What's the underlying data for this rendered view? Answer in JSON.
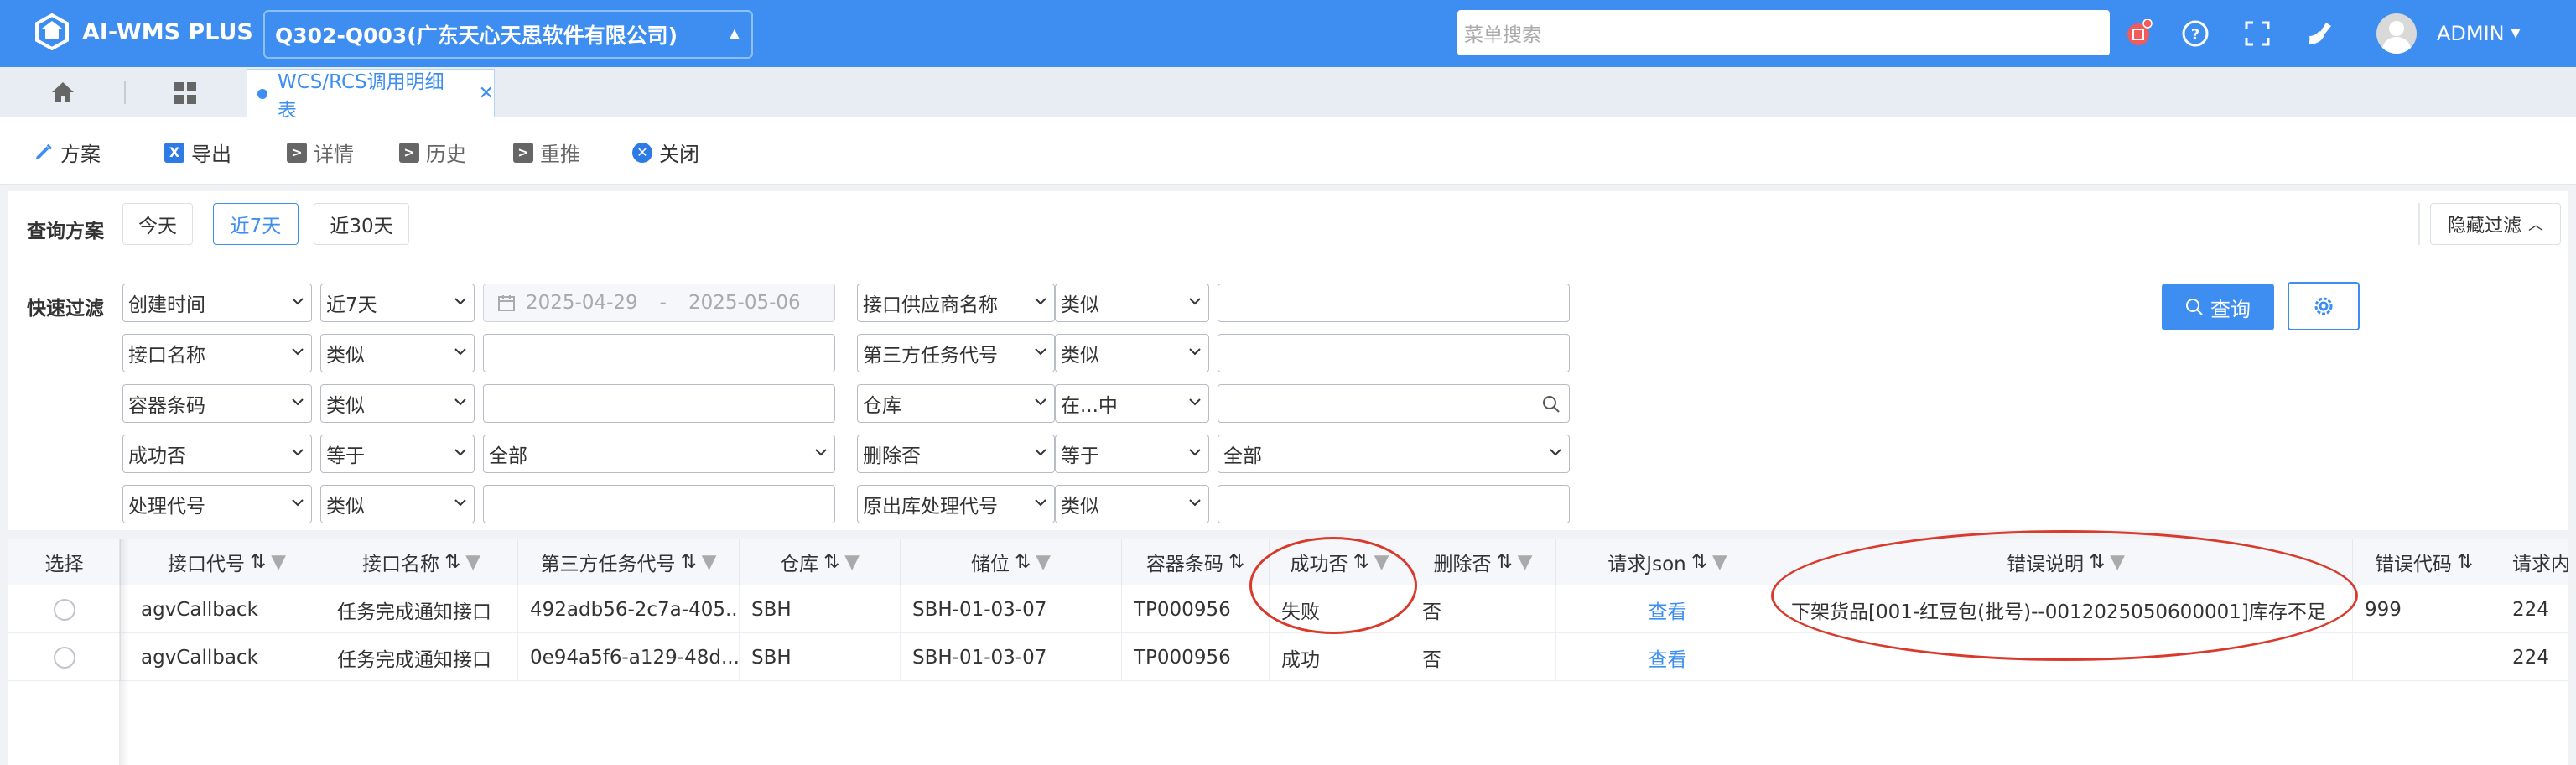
{
  "app": {
    "title": "AI-WMS PLUS",
    "company": "Q302-Q003(广东天心天思软件有限公司)",
    "search_placeholder": "菜单搜索",
    "user": "ADMIN",
    "brand_color": "#3d8ef0"
  },
  "tabs": [
    {
      "label": "WCS/RCS调用明细表",
      "active": true
    }
  ],
  "toolbar": {
    "items": [
      {
        "label": "方案",
        "icon": "plan-icon"
      },
      {
        "label": "导出",
        "icon": "excel-icon"
      },
      {
        "label": "详情",
        "icon": "detail-icon"
      },
      {
        "label": "历史",
        "icon": "history-icon"
      },
      {
        "label": "重推",
        "icon": "repush-icon"
      },
      {
        "label": "关闭",
        "icon": "close-circle-icon"
      }
    ]
  },
  "query": {
    "label": "查询方案",
    "options": [
      "今天",
      "近7天",
      "近30天"
    ],
    "active": "近7天",
    "hide_filter": "隐藏过滤"
  },
  "quick_filter": {
    "label": "快速过滤",
    "left": [
      {
        "field": "创建时间",
        "op": "近7天",
        "date_from": "2025-04-29",
        "date_to": "2025-05-06",
        "date_sep": "-"
      },
      {
        "field": "接口名称",
        "op": "类似",
        "value": ""
      },
      {
        "field": "容器条码",
        "op": "类似",
        "value": ""
      },
      {
        "field": "成功否",
        "op": "等于",
        "value": "全部"
      },
      {
        "field": "处理代号",
        "op": "类似",
        "value": ""
      }
    ],
    "right": [
      {
        "field": "接口供应商名称",
        "op": "类似",
        "value": ""
      },
      {
        "field": "第三方任务代号",
        "op": "类似",
        "value": ""
      },
      {
        "field": "仓库",
        "op": "在...中",
        "value": ""
      },
      {
        "field": "删除否",
        "op": "等于",
        "value": "全部"
      },
      {
        "field": "原出库处理代号",
        "op": "类似",
        "value": ""
      }
    ],
    "search_label": "查询"
  },
  "table": {
    "columns": [
      "选择",
      "接口代号",
      "接口名称",
      "第三方任务代号",
      "仓库",
      "储位",
      "容器条码",
      "成功否",
      "删除否",
      "请求Json",
      "错误说明",
      "错误代码",
      "请求内"
    ],
    "rows": [
      [
        "",
        "agvCallback",
        "任务完成通知接口",
        "492adb56-2c7a-405...",
        "SBH",
        "SBH-01-03-07",
        "TP000956",
        "失败",
        "否",
        "查看",
        "下架货品[001-红豆包(批号)--0012025050600001]库存不足",
        "999",
        "224"
      ],
      [
        "",
        "agvCallback",
        "任务完成通知接口",
        "0e94a5f6-a129-48d...",
        "SBH",
        "SBH-01-03-07",
        "TP000956",
        "成功",
        "否",
        "查看",
        "",
        "",
        "224"
      ]
    ],
    "annotation_color": "#d93a2b"
  }
}
